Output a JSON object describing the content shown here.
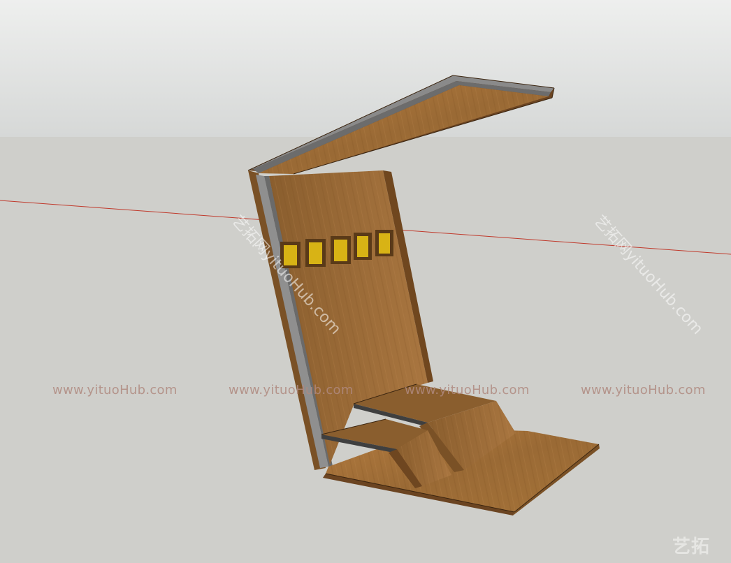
{
  "scene": {
    "sky_color": "#dcdedd",
    "ground_color": "#cfcfcb",
    "wood_color": "#9a6a35",
    "wood_dark": "#6e4620",
    "frame_gray": "#8c8c8c",
    "window_color": "#d8b315",
    "axis_color": "#c0392b"
  },
  "watermarks": {
    "horizontal": [
      "www.yituoHub.com",
      "www.yituoHub.com",
      "www.yituoHub.com",
      "www.yituoHub.com"
    ],
    "diagonal": [
      "艺拓网yituoHub.com",
      "艺拓网yituoHub.com"
    ]
  },
  "logo": "艺拓"
}
